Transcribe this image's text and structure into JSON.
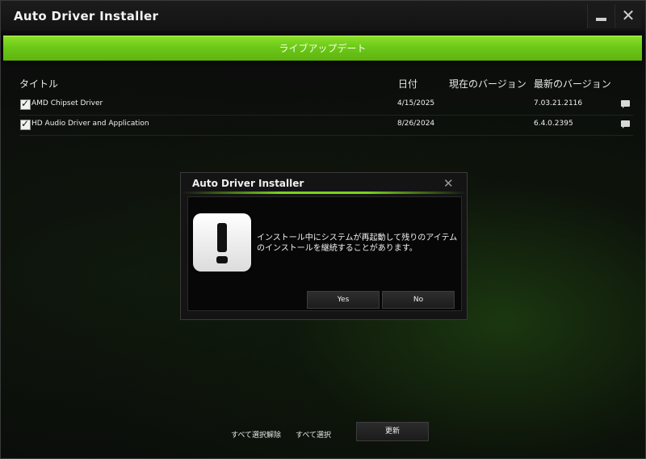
{
  "window": {
    "title": "Auto Driver Installer"
  },
  "toolbar": {
    "live_update_label": "ライブアップデート"
  },
  "table": {
    "headers": [
      "タイトル",
      "日付",
      "現在のバージョン",
      "最新のバージョン"
    ],
    "rows": [
      {
        "checked": true,
        "title": "AMD Chipset Driver",
        "date": "4/15/2025",
        "current": "",
        "latest": "7.03.21.2116"
      },
      {
        "checked": true,
        "title": "HD Audio Driver and Application",
        "date": "8/26/2024",
        "current": "",
        "latest": "6.4.0.2395"
      }
    ]
  },
  "dialog": {
    "title": "Auto Driver Installer",
    "message_line1": "インストール中にシステムが再起動して残りのアイテム",
    "message_line2": "のインストールを継続することがあります。",
    "yes_label": "Yes",
    "no_label": "No",
    "icon": "exclamation-icon"
  },
  "footer": {
    "deselect_all": "すべて選択解除",
    "select_all": "すべて選択",
    "update_label": "更新"
  },
  "colors": {
    "accent": "#6cc818",
    "background": "#0b0c0b"
  }
}
